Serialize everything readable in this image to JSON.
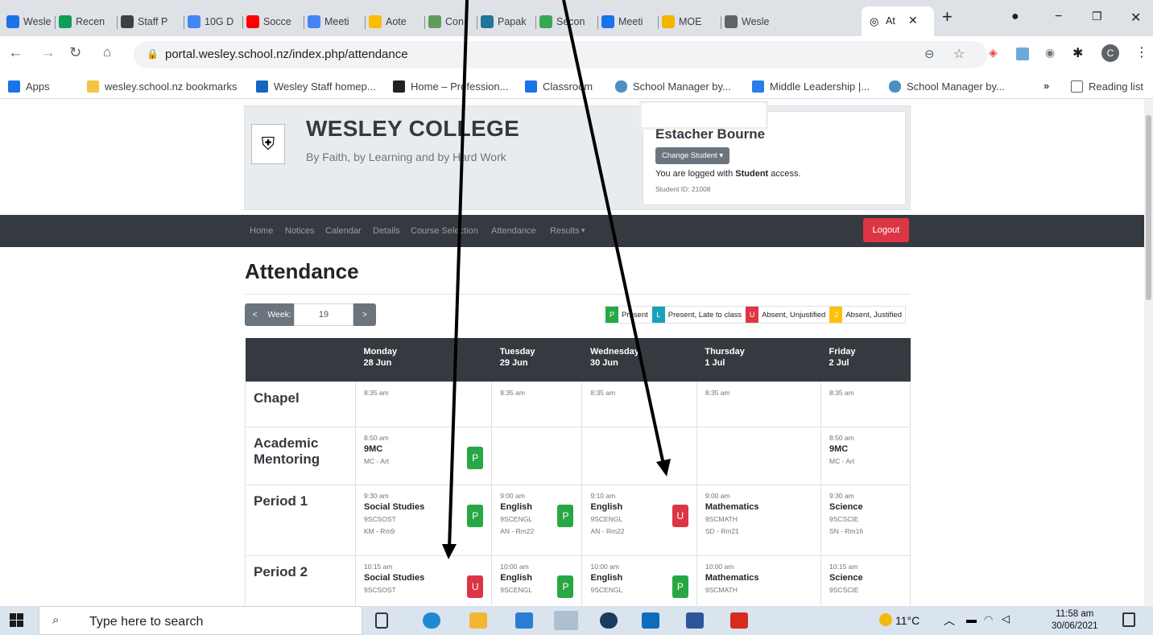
{
  "browser": {
    "tabs": [
      {
        "label": "Wesle",
        "color": "#1a73e8"
      },
      {
        "label": "Recen",
        "color": "#0f9d58"
      },
      {
        "label": "Staff P",
        "color": "#3c4043"
      },
      {
        "label": "10G D",
        "color": "#4285f4"
      },
      {
        "label": "Socce",
        "color": "#ff0000"
      },
      {
        "label": "Meeti",
        "color": "#4285f4"
      },
      {
        "label": "Aote",
        "color": "#fbbc04"
      },
      {
        "label": "Con",
        "color": "#5f9d5c"
      },
      {
        "label": "Papak",
        "color": "#21759b"
      },
      {
        "label": "Secon",
        "color": "#34a853"
      },
      {
        "label": "Meeti",
        "color": "#1a73e8"
      },
      {
        "label": "MOE",
        "color": "#f4b400"
      },
      {
        "label": "Wesle",
        "color": "#5f6368"
      }
    ],
    "active_tab": "At",
    "url": "portal.wesley.school.nz/index.php/attendance",
    "bookmarks": [
      "Apps",
      "wesley.school.nz bookmarks",
      "Wesley Staff homep...",
      "Home – Profession...",
      "Classroom",
      "School Manager by...",
      "Middle Leadership |...",
      "School Manager by..."
    ],
    "reading_list": "Reading list",
    "profile_initial": "C"
  },
  "header": {
    "college": "WESLEY COLLEGE",
    "motto": "By Faith, by Learning and by Hard Work",
    "student_name": "Estacher Bourne",
    "change_student": "Change Student",
    "access_prefix": "You are logged with ",
    "access_role": "Student",
    "access_suffix": " access.",
    "student_id": "Student ID: 21008"
  },
  "nav": {
    "links": [
      "Home",
      "Notices",
      "Calendar",
      "Details",
      "Course Selection",
      "Attendance",
      "Results"
    ],
    "logout": "Logout"
  },
  "attendance": {
    "title": "Attendance",
    "week_prev": "<",
    "week_label": "Week:",
    "week": "19",
    "week_next": ">",
    "legend": [
      {
        "code": "P",
        "label": "Present",
        "color": "#28a745"
      },
      {
        "code": "L",
        "label": "Present, Late to class",
        "color": "#17a2b8"
      },
      {
        "code": "U",
        "label": "Absent, Unjustified",
        "color": "#dc3545"
      },
      {
        "code": "J",
        "label": "Absent, Justified",
        "color": "#ffc107"
      }
    ],
    "days": [
      {
        "name": "Monday",
        "date": "28 Jun"
      },
      {
        "name": "Tuesday",
        "date": "29 Jun"
      },
      {
        "name": "Wednesday",
        "date": "30 Jun"
      },
      {
        "name": "Thursday",
        "date": "1 Jul"
      },
      {
        "name": "Friday",
        "date": "2 Jul"
      }
    ],
    "rows": [
      {
        "label": "Chapel",
        "cells": [
          {
            "time": "8:35 am"
          },
          {
            "time": "8:35 am"
          },
          {
            "time": "8:35 am"
          },
          {
            "time": "8:35 am"
          },
          {
            "time": "8:35 am"
          }
        ]
      },
      {
        "label": "Academic Mentoring",
        "cells": [
          {
            "time": "8:50 am",
            "subject": "9MC",
            "code": "MC - Art",
            "status": "P"
          },
          {},
          {},
          {},
          {
            "time": "8:50 am",
            "subject": "9MC",
            "code": "MC - Art"
          }
        ]
      },
      {
        "label": "Period 1",
        "cells": [
          {
            "time": "9:30 am",
            "subject": "Social Studies",
            "code": "9SCSOST",
            "room": "KM - Rm9",
            "status": "P"
          },
          {
            "time": "9:00 am",
            "subject": "English",
            "code": "9SCENGL",
            "room": "AN - Rm22",
            "status": "P"
          },
          {
            "time": "9:10 am",
            "subject": "English",
            "code": "9SCENGL",
            "room": "AN - Rm22",
            "status": "U"
          },
          {
            "time": "9:00 am",
            "subject": "Mathematics",
            "code": "9SCMATH",
            "room": "SD - Rm21"
          },
          {
            "time": "9:30 am",
            "subject": "Science",
            "code": "9SCSCIE",
            "room": "SN - Rm16"
          }
        ]
      },
      {
        "label": "Period 2",
        "cells": [
          {
            "time": "10:15 am",
            "subject": "Social Studies",
            "code": "9SCSOST",
            "status": "U"
          },
          {
            "time": "10:00 am",
            "subject": "English",
            "code": "9SCENGL",
            "status": "P"
          },
          {
            "time": "10:00 am",
            "subject": "English",
            "code": "9SCENGL",
            "status": "P"
          },
          {
            "time": "10:00 am",
            "subject": "Mathematics",
            "code": "9SCMATH"
          },
          {
            "time": "10:15 am",
            "subject": "Science",
            "code": "9SCSCIE"
          }
        ]
      }
    ]
  },
  "taskbar": {
    "search_placeholder": "Type here to search",
    "weather": "11°C",
    "time": "11:58 am",
    "date": "30/06/2021"
  }
}
